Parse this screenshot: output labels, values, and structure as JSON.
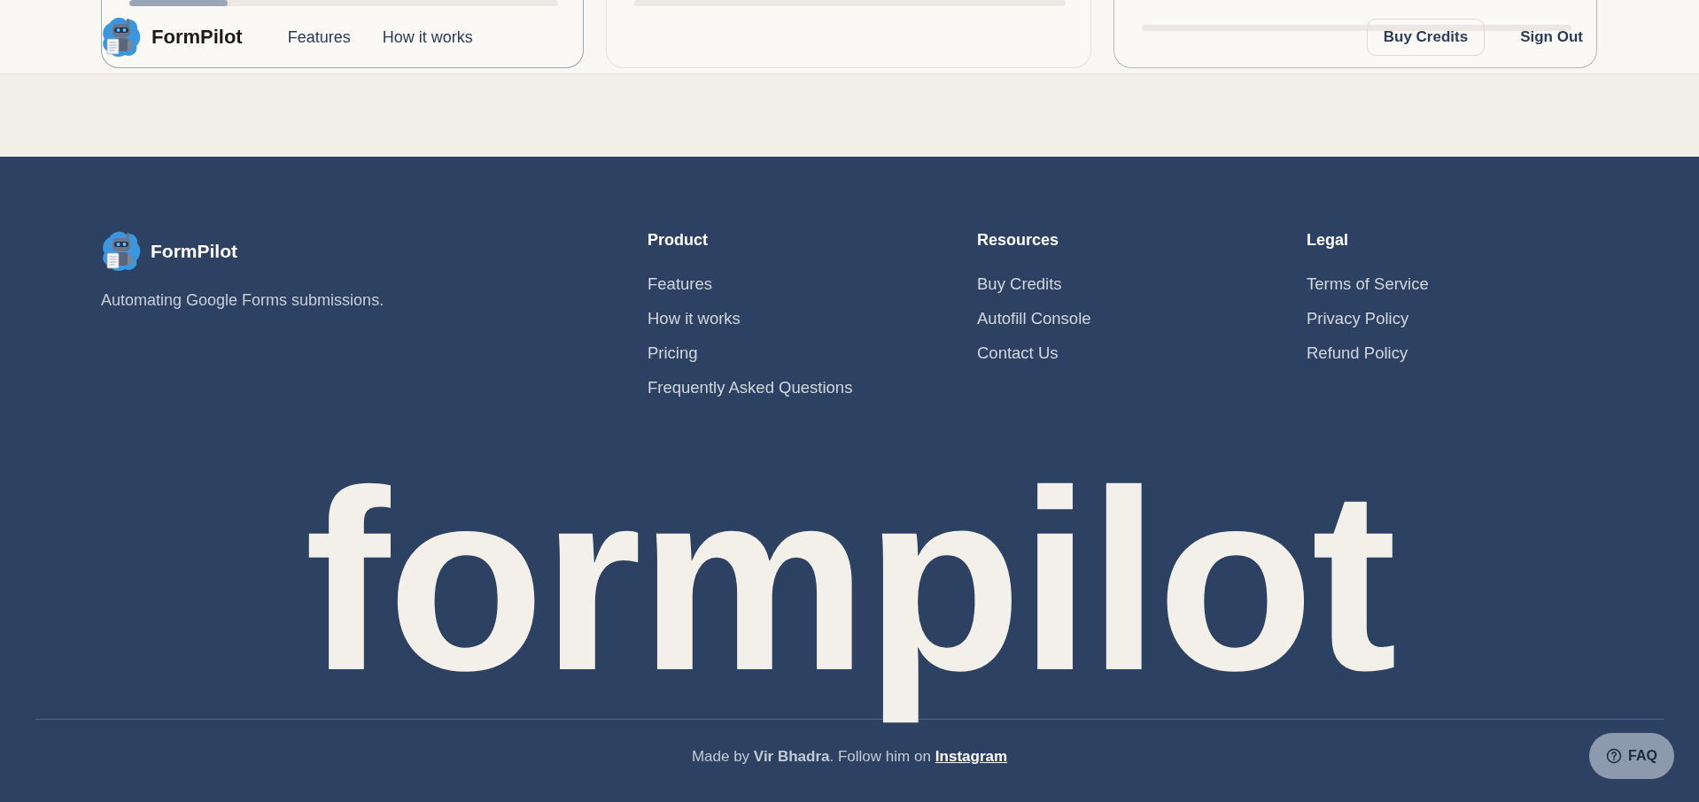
{
  "header": {
    "brand": "FormPilot",
    "nav_links": [
      "Features",
      "How it works"
    ],
    "actions": [
      {
        "label": "Buy Credits",
        "kind": "outlined"
      },
      {
        "label": "Sign Out",
        "kind": "plain"
      }
    ]
  },
  "background_cards": [
    {
      "kind": "progress",
      "level": 0.23
    },
    {
      "kind": "track"
    },
    {
      "kind": "track"
    }
  ],
  "footer": {
    "brand": "FormPilot",
    "tagline": "Automating Google Forms submissions.",
    "columns": [
      {
        "heading": "Product",
        "links": [
          "Features",
          "How it works",
          "Pricing",
          "Frequently Asked Questions"
        ]
      },
      {
        "heading": "Resources",
        "links": [
          "Buy Credits",
          "Autofill Console",
          "Contact Us"
        ]
      },
      {
        "heading": "Legal",
        "links": [
          "Terms of Service",
          "Privacy Policy",
          "Refund Policy"
        ]
      }
    ],
    "wordmark": "formpilot",
    "credit": {
      "text": "Made by **Vir Bhadra**. Follow him on",
      "link": "Instagram"
    }
  },
  "faq_button": {
    "label": "FAQ"
  }
}
